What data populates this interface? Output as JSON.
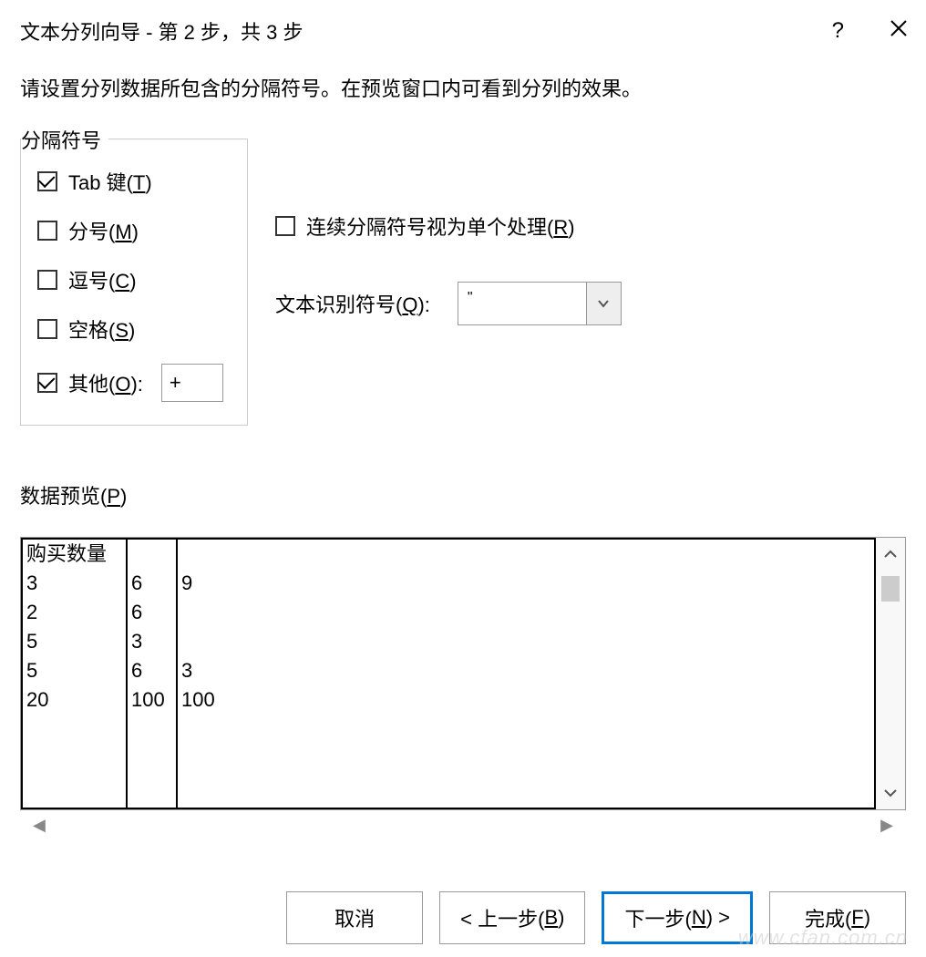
{
  "titlebar": {
    "title": "文本分列向导 - 第 2 步，共 3 步"
  },
  "instruction": "请设置分列数据所包含的分隔符号。在预览窗口内可看到分列的效果。",
  "delimiters": {
    "legend": "分隔符号",
    "tab": {
      "label": "Tab 键(T)",
      "checked": true
    },
    "semicolon": {
      "label": "分号(M)",
      "checked": false
    },
    "comma": {
      "label": "逗号(C)",
      "checked": false
    },
    "space": {
      "label": "空格(S)",
      "checked": false
    },
    "other": {
      "label": "其他(O):",
      "checked": true,
      "value": "+"
    }
  },
  "options": {
    "consecutive": {
      "label": "连续分隔符号视为单个处理(R)",
      "checked": false
    },
    "text_qualifier": {
      "label": "文本识别符号(Q):",
      "value": "\""
    }
  },
  "preview": {
    "label": "数据预览(P)",
    "header": "购买数量",
    "rows": [
      [
        "3",
        "6",
        "9"
      ],
      [
        "2",
        "6",
        ""
      ],
      [
        "5",
        "3",
        ""
      ],
      [
        "5",
        "6",
        "3"
      ],
      [
        "20",
        "100",
        "100"
      ]
    ]
  },
  "buttons": {
    "cancel": "取消",
    "back": "< 上一步(B)",
    "next": "下一步(N) >",
    "finish": "完成(F)"
  },
  "watermark": "www.cfan.com.cn"
}
